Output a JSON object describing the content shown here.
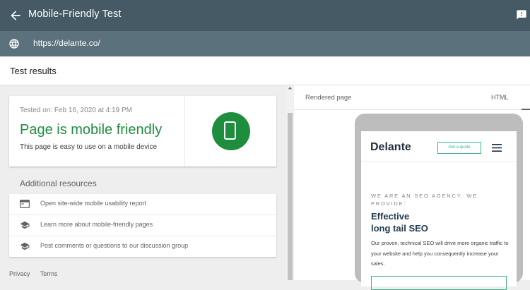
{
  "header": {
    "title": "Mobile-Friendly Test"
  },
  "urlbar": {
    "url": "https://delante.co/"
  },
  "results": {
    "heading": "Test results"
  },
  "result_card": {
    "tested_on": "Tested on: Feb 16, 2020 at 4:19 PM",
    "verdict": "Page is mobile friendly",
    "description": "This page is easy to use on a mobile device",
    "accent_color": "#1e8e3e"
  },
  "resources": {
    "title": "Additional resources",
    "items": [
      {
        "icon": "report-icon",
        "label": "Open site-wide mobile usability report"
      },
      {
        "icon": "school-icon",
        "label": "Learn more about mobile-friendly pages"
      },
      {
        "icon": "school-icon",
        "label": "Post comments or questions to our discussion group"
      }
    ]
  },
  "footer": {
    "privacy": "Privacy",
    "terms": "Terms"
  },
  "rendered": {
    "label": "Rendered page",
    "html_tab": "HTML",
    "site": {
      "logo": "Delante",
      "quote_button": "Get a quote",
      "tagline": "WE ARE AN SEO AGENCY. WE PROVIDE:",
      "headline_line1": "Effective",
      "headline_line2": "long tail SEO",
      "paragraph": "Our proven, technical SEO will drive more organic traffic to your website and help you consequently increase your sales."
    }
  }
}
